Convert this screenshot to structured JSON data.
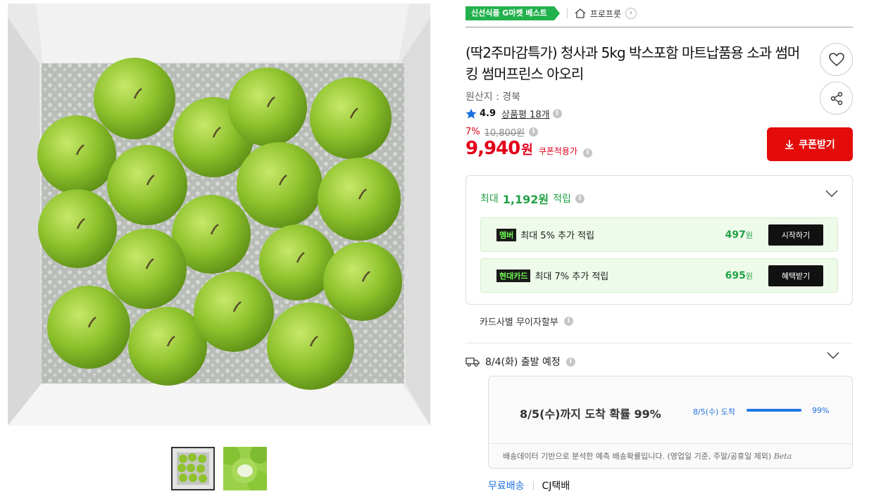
{
  "badge": {
    "text": "신선식품 G마켓 베스트"
  },
  "store": {
    "name": "프로프룻"
  },
  "product": {
    "title": "(딱2주마감특가) 청사과 5kg 박스포함 마트납품용 소과 썸머킹 썸머프린스 아오리",
    "origin": "원산지 : 경북",
    "rating": "4.9",
    "review_label": "상품평 18개",
    "discount_pct": "7%",
    "original_price": "10,800원",
    "price": "9,940",
    "price_unit": "원",
    "price_note": "쿠폰적용가"
  },
  "coupon_button": {
    "label": "쿠폰받기"
  },
  "reward": {
    "head_prefix": "최대",
    "head_amount": "1,192원",
    "head_suffix": "적립",
    "items": [
      {
        "tag": "멤버",
        "text": "최대 5% 추가 적립",
        "amount": "497",
        "unit": "원",
        "button": "시작하기"
      },
      {
        "tag": "현대카드",
        "text": "최대 7% 추가 적립",
        "amount": "695",
        "unit": "원",
        "button": "혜택받기"
      }
    ]
  },
  "installment": {
    "text": "카드사별 무이자할부"
  },
  "shipping": {
    "departure": "8/4(화) 출발 예정",
    "arrival_main": "8/5(수)까지 도착 확률 99%",
    "bar_label": "8/5(수) 도착",
    "bar_pct_text": "99%",
    "bar_fraction": 0.99,
    "note": "배송데이터 기반으로 분석한 예측 배송확률입니다. (영업일 기준, 주말/공휴일 제외)",
    "beta": "Beta",
    "free": "무료배송",
    "courier": "CJ택배"
  },
  "colors": {
    "accent_red": "#e40b0b",
    "price_red": "#e2001a",
    "green": "#22a146",
    "badge_green": "#22b14c",
    "blue": "#1f6fde"
  },
  "icons": [
    "home-icon",
    "chevron-right-icon",
    "heart-icon",
    "share-icon",
    "star-icon",
    "info-icon",
    "download-icon",
    "chevron-down-icon",
    "truck-icon"
  ]
}
